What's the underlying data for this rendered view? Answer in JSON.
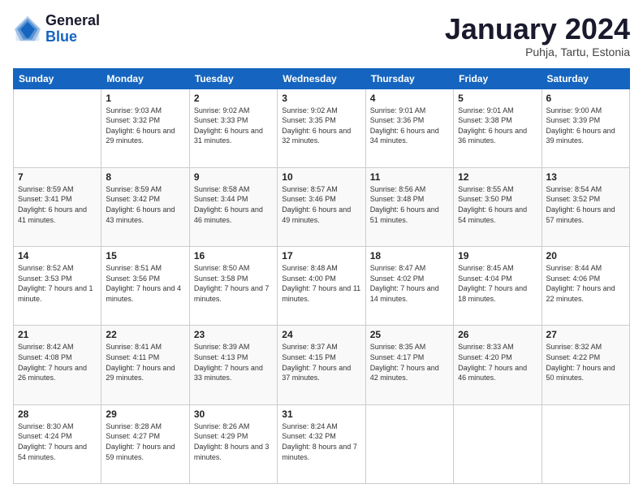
{
  "logo": {
    "general": "General",
    "blue": "Blue"
  },
  "title": "January 2024",
  "location": "Puhja, Tartu, Estonia",
  "weekdays": [
    "Sunday",
    "Monday",
    "Tuesday",
    "Wednesday",
    "Thursday",
    "Friday",
    "Saturday"
  ],
  "weeks": [
    [
      {
        "day": "",
        "content": ""
      },
      {
        "day": "1",
        "content": "Sunrise: 9:03 AM\nSunset: 3:32 PM\nDaylight: 6 hours\nand 29 minutes."
      },
      {
        "day": "2",
        "content": "Sunrise: 9:02 AM\nSunset: 3:33 PM\nDaylight: 6 hours\nand 31 minutes."
      },
      {
        "day": "3",
        "content": "Sunrise: 9:02 AM\nSunset: 3:35 PM\nDaylight: 6 hours\nand 32 minutes."
      },
      {
        "day": "4",
        "content": "Sunrise: 9:01 AM\nSunset: 3:36 PM\nDaylight: 6 hours\nand 34 minutes."
      },
      {
        "day": "5",
        "content": "Sunrise: 9:01 AM\nSunset: 3:38 PM\nDaylight: 6 hours\nand 36 minutes."
      },
      {
        "day": "6",
        "content": "Sunrise: 9:00 AM\nSunset: 3:39 PM\nDaylight: 6 hours\nand 39 minutes."
      }
    ],
    [
      {
        "day": "7",
        "content": "Sunrise: 8:59 AM\nSunset: 3:41 PM\nDaylight: 6 hours\nand 41 minutes."
      },
      {
        "day": "8",
        "content": "Sunrise: 8:59 AM\nSunset: 3:42 PM\nDaylight: 6 hours\nand 43 minutes."
      },
      {
        "day": "9",
        "content": "Sunrise: 8:58 AM\nSunset: 3:44 PM\nDaylight: 6 hours\nand 46 minutes."
      },
      {
        "day": "10",
        "content": "Sunrise: 8:57 AM\nSunset: 3:46 PM\nDaylight: 6 hours\nand 49 minutes."
      },
      {
        "day": "11",
        "content": "Sunrise: 8:56 AM\nSunset: 3:48 PM\nDaylight: 6 hours\nand 51 minutes."
      },
      {
        "day": "12",
        "content": "Sunrise: 8:55 AM\nSunset: 3:50 PM\nDaylight: 6 hours\nand 54 minutes."
      },
      {
        "day": "13",
        "content": "Sunrise: 8:54 AM\nSunset: 3:52 PM\nDaylight: 6 hours\nand 57 minutes."
      }
    ],
    [
      {
        "day": "14",
        "content": "Sunrise: 8:52 AM\nSunset: 3:53 PM\nDaylight: 7 hours\nand 1 minute."
      },
      {
        "day": "15",
        "content": "Sunrise: 8:51 AM\nSunset: 3:56 PM\nDaylight: 7 hours\nand 4 minutes."
      },
      {
        "day": "16",
        "content": "Sunrise: 8:50 AM\nSunset: 3:58 PM\nDaylight: 7 hours\nand 7 minutes."
      },
      {
        "day": "17",
        "content": "Sunrise: 8:48 AM\nSunset: 4:00 PM\nDaylight: 7 hours\nand 11 minutes."
      },
      {
        "day": "18",
        "content": "Sunrise: 8:47 AM\nSunset: 4:02 PM\nDaylight: 7 hours\nand 14 minutes."
      },
      {
        "day": "19",
        "content": "Sunrise: 8:45 AM\nSunset: 4:04 PM\nDaylight: 7 hours\nand 18 minutes."
      },
      {
        "day": "20",
        "content": "Sunrise: 8:44 AM\nSunset: 4:06 PM\nDaylight: 7 hours\nand 22 minutes."
      }
    ],
    [
      {
        "day": "21",
        "content": "Sunrise: 8:42 AM\nSunset: 4:08 PM\nDaylight: 7 hours\nand 26 minutes."
      },
      {
        "day": "22",
        "content": "Sunrise: 8:41 AM\nSunset: 4:11 PM\nDaylight: 7 hours\nand 29 minutes."
      },
      {
        "day": "23",
        "content": "Sunrise: 8:39 AM\nSunset: 4:13 PM\nDaylight: 7 hours\nand 33 minutes."
      },
      {
        "day": "24",
        "content": "Sunrise: 8:37 AM\nSunset: 4:15 PM\nDaylight: 7 hours\nand 37 minutes."
      },
      {
        "day": "25",
        "content": "Sunrise: 8:35 AM\nSunset: 4:17 PM\nDaylight: 7 hours\nand 42 minutes."
      },
      {
        "day": "26",
        "content": "Sunrise: 8:33 AM\nSunset: 4:20 PM\nDaylight: 7 hours\nand 46 minutes."
      },
      {
        "day": "27",
        "content": "Sunrise: 8:32 AM\nSunset: 4:22 PM\nDaylight: 7 hours\nand 50 minutes."
      }
    ],
    [
      {
        "day": "28",
        "content": "Sunrise: 8:30 AM\nSunset: 4:24 PM\nDaylight: 7 hours\nand 54 minutes."
      },
      {
        "day": "29",
        "content": "Sunrise: 8:28 AM\nSunset: 4:27 PM\nDaylight: 7 hours\nand 59 minutes."
      },
      {
        "day": "30",
        "content": "Sunrise: 8:26 AM\nSunset: 4:29 PM\nDaylight: 8 hours\nand 3 minutes."
      },
      {
        "day": "31",
        "content": "Sunrise: 8:24 AM\nSunset: 4:32 PM\nDaylight: 8 hours\nand 7 minutes."
      },
      {
        "day": "",
        "content": ""
      },
      {
        "day": "",
        "content": ""
      },
      {
        "day": "",
        "content": ""
      }
    ]
  ]
}
